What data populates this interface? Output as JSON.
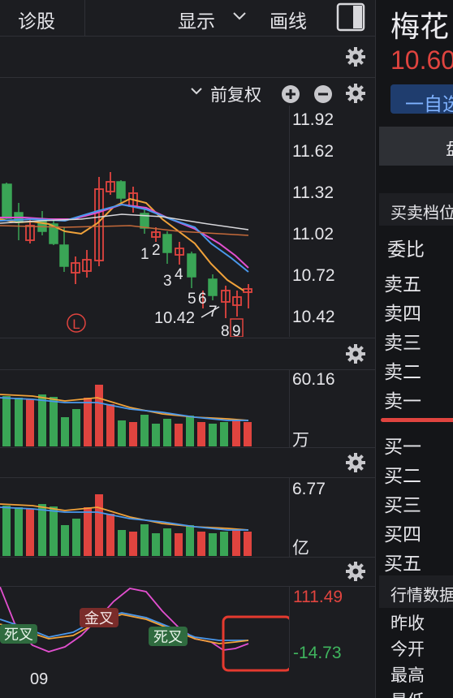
{
  "toolbar": {
    "diagnose": "诊股",
    "display": "显示",
    "draw": "画线"
  },
  "stock": {
    "name": "梅花",
    "price": "10.60",
    "watch_button": "一自选"
  },
  "kline": {
    "adjust": "前复权",
    "axis": [
      "11.92",
      "11.62",
      "11.32",
      "11.02",
      "10.72",
      "10.42"
    ],
    "low_label": "10.42",
    "seq_labels": [
      "1",
      "2",
      "3",
      "4",
      "5",
      "6",
      "7",
      "8",
      "9"
    ],
    "marker": "L"
  },
  "volume": {
    "top": "60.16",
    "unit": "万"
  },
  "amount": {
    "top": "6.77",
    "unit": "亿"
  },
  "indicator": {
    "top": "111.49",
    "bottom": "-14.73",
    "x_label": "09",
    "signals": [
      "死叉",
      "金叉",
      "死叉"
    ]
  },
  "order_book": {
    "tab": "盘",
    "section": "买卖档位",
    "ratio": "委比",
    "sell": [
      "卖五",
      "卖四",
      "卖三",
      "卖二",
      "卖一"
    ],
    "buy": [
      "买一",
      "买二",
      "买三",
      "买四",
      "买五"
    ]
  },
  "quote": {
    "section": "行情数据",
    "rows": [
      "昨收",
      "今开",
      "最高",
      "最低"
    ]
  },
  "colors": {
    "up": "#e0443f",
    "down": "#3aa556",
    "price": "#e0443f",
    "highlight_box": "#e53a2f"
  }
}
